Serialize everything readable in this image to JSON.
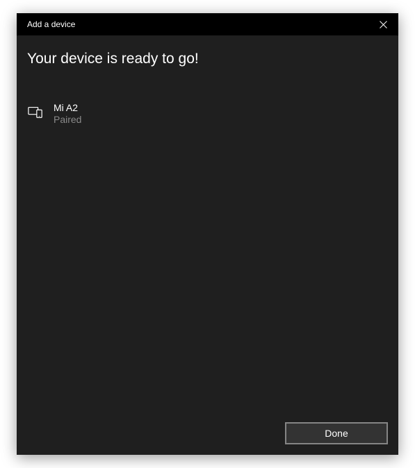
{
  "titlebar": {
    "title": "Add a device"
  },
  "main": {
    "heading": "Your device is ready to go!"
  },
  "device": {
    "name": "Mi A2",
    "status": "Paired"
  },
  "footer": {
    "done_label": "Done"
  }
}
